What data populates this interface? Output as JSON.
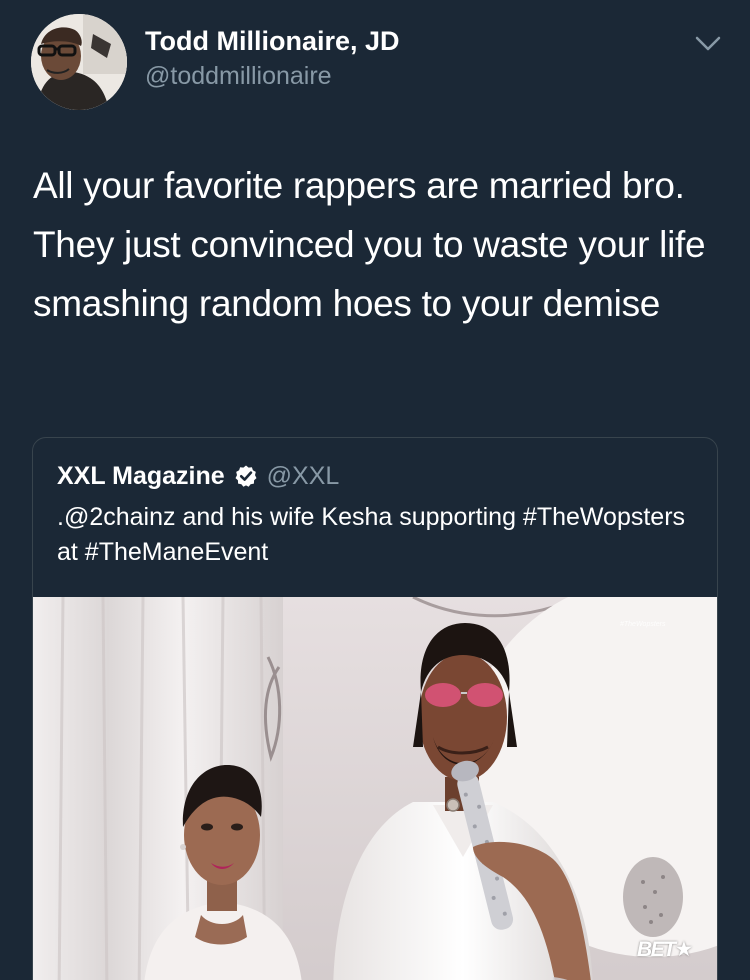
{
  "tweet": {
    "author_name": "Todd Millionaire, JD",
    "author_handle": "@toddmillionaire",
    "text": "All your favorite rappers are married bro. They just convinced you to waste your life smashing random hoes to your demise",
    "menu_icon": "chevron-down-icon"
  },
  "quote": {
    "author_name": "XXL Magazine",
    "verified_icon": "verified-badge-icon",
    "author_handle": "@XXL",
    "text": ".@2chainz and his wife Kesha supporting #TheWopsters at #TheManeEvent",
    "media": {
      "watermark": "#TheWopsters",
      "network_logo": "BET★"
    }
  },
  "colors": {
    "background": "#1b2836",
    "text_primary": "#ffffff",
    "text_secondary": "#8899a6",
    "card_border": "#38444d",
    "verified": "#ffffff"
  }
}
